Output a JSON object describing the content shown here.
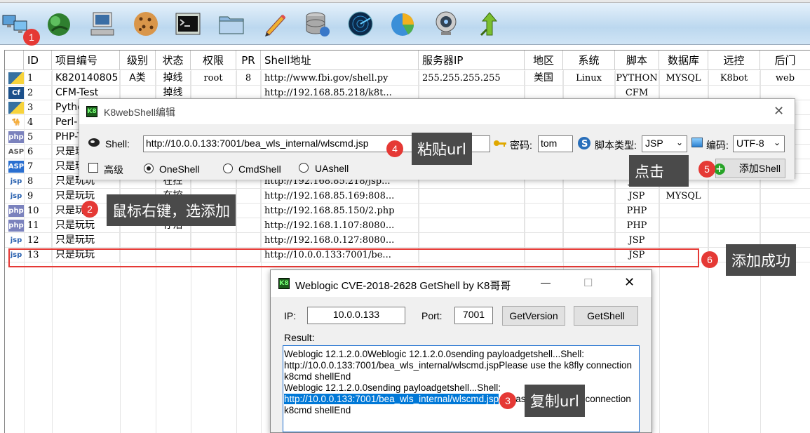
{
  "toolbar": {
    "items": [
      {
        "icon": "network-computers-icon"
      },
      {
        "icon": "green-orb-icon"
      },
      {
        "icon": "computer-terminal-icon"
      },
      {
        "icon": "cookie-icon"
      },
      {
        "icon": "console-icon"
      },
      {
        "icon": "folder-icon"
      },
      {
        "icon": "pencil-edit-icon"
      },
      {
        "icon": "database-icon"
      },
      {
        "icon": "radar-scan-icon"
      },
      {
        "icon": "pie-chart-icon"
      },
      {
        "icon": "webcam-icon"
      },
      {
        "icon": "branch-arrow-icon"
      }
    ]
  },
  "table": {
    "headers": [
      "ID",
      "项目编号",
      "级别",
      "状态",
      "权限",
      "PR",
      "Shell地址",
      "服务器IP",
      "地区",
      "系统",
      "脚本",
      "数据库",
      "远控",
      "后门"
    ],
    "rows": [
      {
        "icon": "python",
        "id": "1",
        "proj": "K820140805",
        "level": "A类",
        "status": "掉线",
        "perm": "root",
        "pr": "8",
        "url": "http://www.fbi.gov/shell.py",
        "ip": "255.255.255.255",
        "region": "美国",
        "os": "Linux",
        "script": "PYTHON",
        "db": "MYSQL",
        "rc": "K8bot",
        "bd": "web"
      },
      {
        "icon": "cf",
        "id": "2",
        "proj": "CFM-Test",
        "level": "",
        "status": "掉线",
        "perm": "",
        "pr": "",
        "url": "http://192.168.85.218/k8t...",
        "ip": "",
        "region": "",
        "os": "",
        "script": "CFM",
        "db": "",
        "rc": "",
        "bd": ""
      },
      {
        "icon": "python",
        "id": "3",
        "proj": "Pytho",
        "level": "",
        "status": "",
        "perm": "",
        "pr": "",
        "url": "",
        "ip": "",
        "region": "",
        "os": "",
        "script": "",
        "db": "",
        "rc": "",
        "bd": ""
      },
      {
        "icon": "camel",
        "id": "4",
        "proj": "Perl-",
        "level": "",
        "status": "",
        "perm": "",
        "pr": "",
        "url": "",
        "ip": "",
        "region": "",
        "os": "",
        "script": "",
        "db": "",
        "rc": "",
        "bd": ""
      },
      {
        "icon": "php",
        "id": "5",
        "proj": "PHP-T",
        "level": "",
        "status": "",
        "perm": "",
        "pr": "",
        "url": "",
        "ip": "",
        "region": "",
        "os": "",
        "script": "",
        "db": "",
        "rc": "",
        "bd": ""
      },
      {
        "icon": "asp",
        "id": "6",
        "proj": "只是玩",
        "level": "",
        "status": "",
        "perm": "",
        "pr": "",
        "url": "",
        "ip": "",
        "region": "",
        "os": "",
        "script": "",
        "db": "",
        "rc": "",
        "bd": ""
      },
      {
        "icon": "aspnet",
        "id": "7",
        "proj": "只是玩",
        "level": "",
        "status": "",
        "perm": "",
        "pr": "",
        "url": "",
        "ip": "",
        "region": "",
        "os": "",
        "script": "",
        "db": "",
        "rc": "",
        "bd": ""
      },
      {
        "icon": "jsp",
        "id": "8",
        "proj": "只是玩玩",
        "level": "",
        "status": "在控",
        "perm": "",
        "pr": "",
        "url": "http://192.168.85.218/jsp...",
        "ip": "",
        "region": "",
        "os": "",
        "script": "JSP",
        "db": "",
        "rc": "",
        "bd": ""
      },
      {
        "icon": "jsp",
        "id": "9",
        "proj": "只是玩玩",
        "level": "",
        "status": "在控",
        "perm": "",
        "pr": "",
        "url": "http://192.168.85.169:808...",
        "ip": "",
        "region": "",
        "os": "",
        "script": "JSP",
        "db": "MYSQL",
        "rc": "",
        "bd": ""
      },
      {
        "icon": "php",
        "id": "10",
        "proj": "只是玩",
        "level": "",
        "status": "",
        "perm": "",
        "pr": "",
        "url": "http://192.168.85.150/2.php",
        "ip": "",
        "region": "",
        "os": "",
        "script": "PHP",
        "db": "",
        "rc": "",
        "bd": ""
      },
      {
        "icon": "php",
        "id": "11",
        "proj": "只是玩玩",
        "level": "",
        "status": "存活",
        "perm": "",
        "pr": "",
        "url": "http://192.168.1.107:8080...",
        "ip": "",
        "region": "",
        "os": "",
        "script": "PHP",
        "db": "",
        "rc": "",
        "bd": ""
      },
      {
        "icon": "jsp",
        "id": "12",
        "proj": "只是玩玩",
        "level": "",
        "status": "",
        "perm": "",
        "pr": "",
        "url": "http://192.168.0.127:8080...",
        "ip": "",
        "region": "",
        "os": "",
        "script": "JSP",
        "db": "",
        "rc": "",
        "bd": ""
      },
      {
        "icon": "jsp",
        "id": "13",
        "proj": "只是玩玩",
        "level": "",
        "status": "",
        "perm": "",
        "pr": "",
        "url": "http://10.0.0.133:7001/be...",
        "ip": "",
        "region": "",
        "os": "",
        "script": "JSP",
        "db": "",
        "rc": "",
        "bd": ""
      }
    ]
  },
  "edit_dialog": {
    "title": "K8webShell编辑",
    "logo_text": "K8",
    "shell_label": "Shell:",
    "shell_value": "http://10.0.0.133:7001/bea_wls_internal/wlscmd.jsp",
    "password_label": "密码:",
    "password_value": "tom",
    "script_type_label": "脚本类型:",
    "script_type_value": "JSP",
    "encoding_label": "编码:",
    "encoding_value": "UTF-8",
    "advanced_label": "高级",
    "radio_oneshell": "OneShell",
    "radio_cmdshell": "CmdShell",
    "radio_uashell": "UAshell",
    "add_button": "添加Shell",
    "close": "✕"
  },
  "getshell_dialog": {
    "title": "Weblogic CVE-2018-2628 GetShell by K8哥哥",
    "logo_text": "K8",
    "ip_label": "IP:",
    "ip_value": "10.0.0.133",
    "port_label": "Port:",
    "port_value": "7001",
    "getversion_button": "GetVersion",
    "getshell_button": "GetShell",
    "result_label": "Result:",
    "result_lines": [
      "Weblogic 12.1.2.0.0Weblogic 12.1.2.0.0sending payloadgetshell...Shell:",
      "http://10.0.0.133:7001/bea_wls_internal/wlscmd.jspPlease use the k8fly connection",
      "k8cmd shellEnd",
      "Weblogic 12.1.2.0.0sending payloadgetshell...Shell:"
    ],
    "result_selected": "http://10.0.0.133:7001/bea_wls_internal/wlscmd.jsp",
    "result_after_sel_a": "ase",
    "result_after_sel_b": "ly connection",
    "result_last": "k8cmd shellEnd",
    "minimize": "—",
    "maximize": "☐",
    "close": "✕"
  },
  "callouts": {
    "b1": "1",
    "b2": "2",
    "b3": "3",
    "b4": "4",
    "b5": "5",
    "b6": "6",
    "n2": "鼠标右键，选添加",
    "n3": "复制url",
    "n4": "粘贴url",
    "n5": "点击",
    "n6": "添加成功"
  },
  "colors": {
    "badge": "#e53935",
    "note_bg": "#4a4a4a",
    "selection": "#0078d7"
  }
}
